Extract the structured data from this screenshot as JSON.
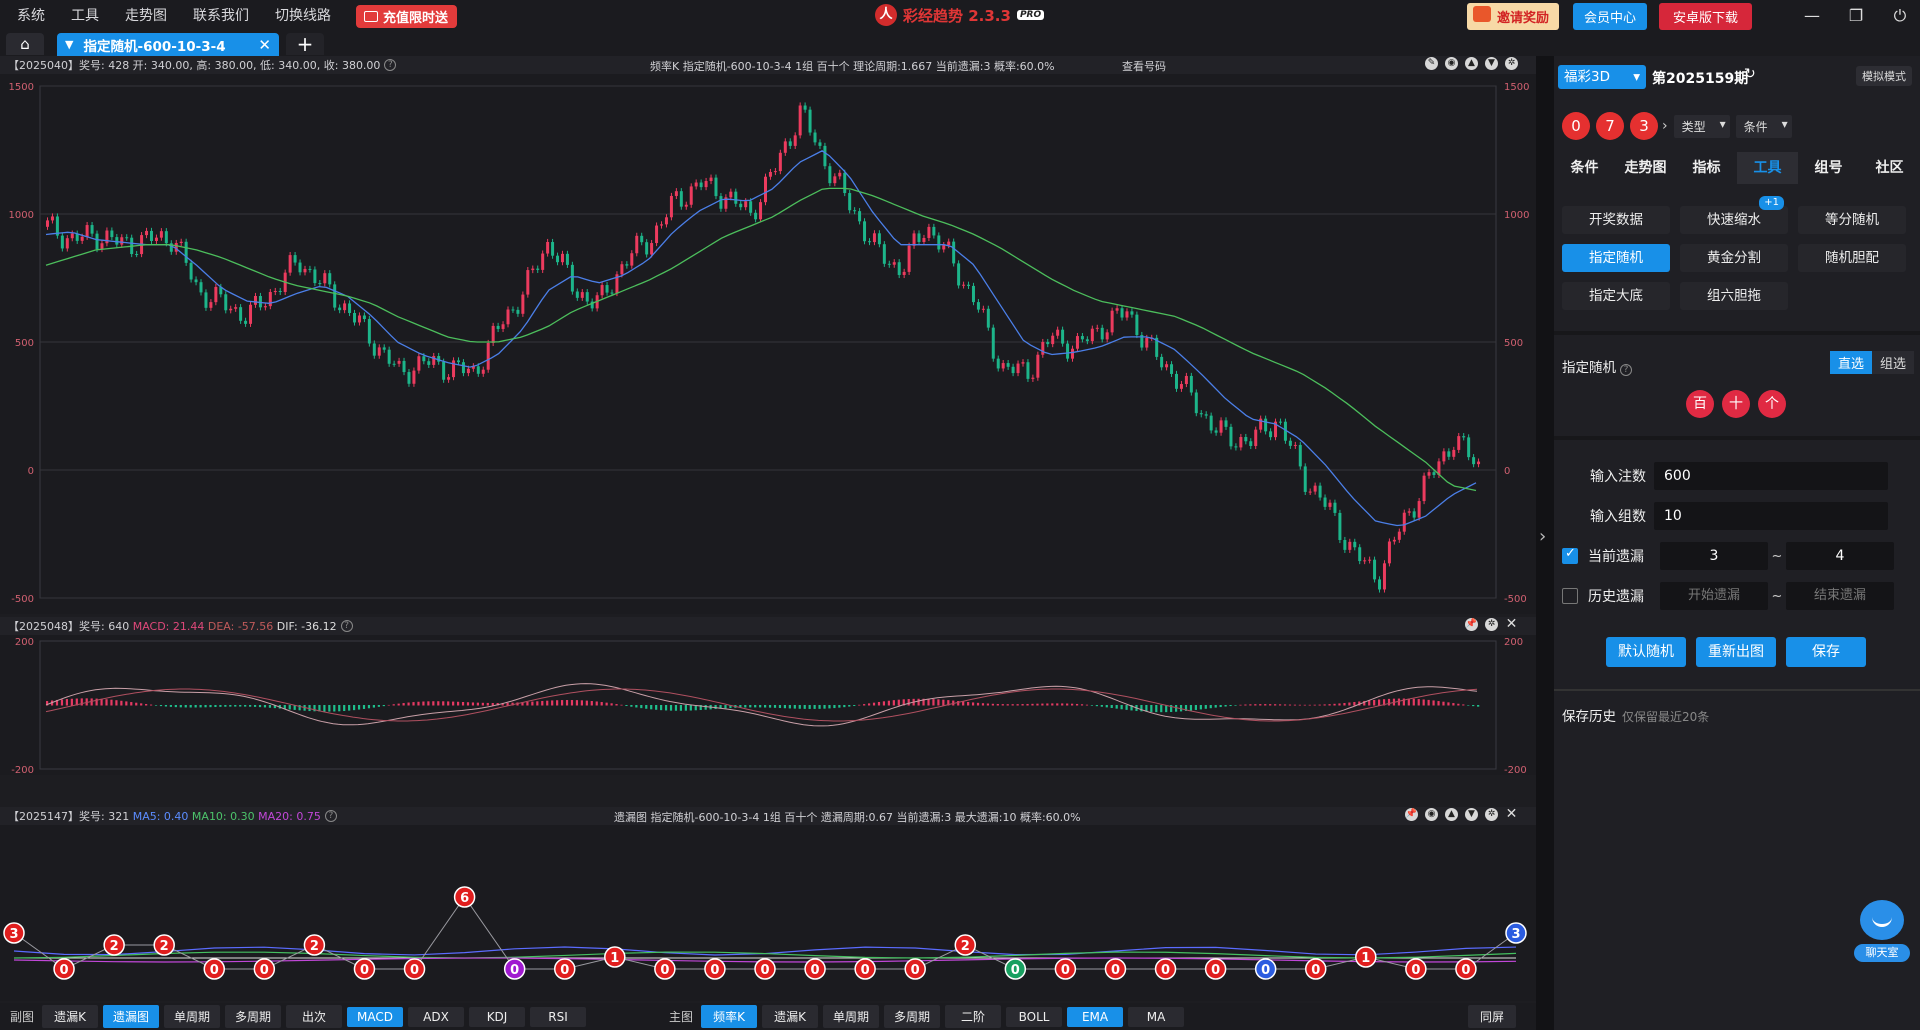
{
  "menu": [
    "系统",
    "工具",
    "走势图",
    "联系我们",
    "切换线路"
  ],
  "promo_label": "充值限时送",
  "app": {
    "name": "彩经趋势 2.3.3",
    "badge": "PRO"
  },
  "topright": {
    "invite": "邀请奖励",
    "vip": "会员中心",
    "android": "安卓版下载"
  },
  "tab": {
    "title": "指定随机-600-10-3-4"
  },
  "kchart": {
    "header_left": "【2025040】奖号: 428  开: 340.00, 高: 380.00, 低: 340.00, 收: 380.00",
    "header_mid": "频率K  指定随机-600-10-3-4  1组  百十个  理论周期:1.667  当前遗漏:3  概率:60.0%",
    "header_link": "查看号码",
    "yticks": [
      "1500",
      "1000",
      "500",
      "0",
      "-500"
    ]
  },
  "macd": {
    "header_prefix": "【2025048】奖号: 640",
    "macd_label": "MACD: 21.44",
    "dea_label": "DEA: -57.56",
    "dif_label": "DIF: -36.12",
    "yticks": [
      "200",
      "-200"
    ]
  },
  "miss": {
    "header_prefix": "【2025147】奖号: 321",
    "ma5": "MA5: 0.40",
    "ma10": "MA10: 0.30",
    "ma20": "MA20: 0.75",
    "header_mid": "遗漏图  指定随机-600-10-3-4  1组  百十个  遗漏周期:0.67  当前遗漏:3  最大遗漏:10  概率:60.0%"
  },
  "chart_data": [
    {
      "type": "line",
      "title": "频率K",
      "ylim": [
        -500,
        1500
      ],
      "series": [
        {
          "values": [
            950,
            900,
            920,
            880,
            900,
            910,
            700,
            650,
            600,
            700,
            820,
            720,
            620,
            500,
            380,
            420,
            400,
            380,
            560,
            700,
            900,
            700,
            650,
            820,
            900,
            1050,
            1120,
            1070,
            1000,
            1180,
            1400,
            1200,
            1030,
            860,
            780,
            960,
            820,
            650,
            400,
            380,
            520,
            480,
            560,
            620,
            460,
            360,
            220,
            120,
            120,
            200,
            -20,
            -150,
            -320,
            -420,
            -200,
            -40,
            120,
            20
          ]
        },
        {
          "values": [
            920,
            930,
            900,
            890,
            880,
            880,
            800,
            710,
            660,
            650,
            690,
            720,
            680,
            600,
            500,
            450,
            420,
            400,
            450,
            550,
            700,
            760,
            730,
            760,
            820,
            930,
            1010,
            1060,
            1050,
            1100,
            1200,
            1250,
            1150,
            1000,
            880,
            880,
            880,
            800,
            650,
            500,
            450,
            460,
            480,
            520,
            520,
            470,
            380,
            280,
            200,
            180,
            120,
            20,
            -100,
            -200,
            -220,
            -180,
            -100,
            -50
          ]
        },
        {
          "values": [
            800,
            830,
            860,
            870,
            880,
            880,
            860,
            830,
            790,
            750,
            720,
            700,
            680,
            650,
            600,
            560,
            520,
            500,
            500,
            520,
            560,
            620,
            660,
            700,
            740,
            790,
            850,
            910,
            950,
            990,
            1050,
            1100,
            1100,
            1070,
            1030,
            990,
            960,
            920,
            870,
            810,
            750,
            700,
            660,
            640,
            620,
            600,
            560,
            510,
            460,
            420,
            380,
            320,
            250,
            170,
            100,
            30,
            -60,
            -80
          ]
        }
      ]
    },
    {
      "type": "bar",
      "title": "MACD",
      "ylim": [
        -200,
        200
      ],
      "series": [
        {
          "name": "MACD",
          "values": [
            21.44
          ]
        },
        {
          "name": "DEA",
          "values": [
            -57.56
          ]
        },
        {
          "name": "DIF",
          "values": [
            -36.12
          ]
        }
      ]
    },
    {
      "type": "scatter",
      "title": "遗漏图",
      "series": [
        {
          "values": [
            3,
            0,
            2,
            2,
            0,
            0,
            2,
            0,
            0,
            6,
            0,
            0,
            1,
            0,
            0,
            0,
            0,
            0,
            0,
            2,
            0,
            0,
            0,
            0,
            0,
            0,
            0,
            1,
            0,
            0,
            3
          ]
        }
      ]
    }
  ],
  "right": {
    "lottery": "福彩3D",
    "issue": "第2025159期",
    "mock_mode": "模拟模式",
    "balls": [
      "0",
      "7",
      "3"
    ],
    "type_select": "类型",
    "cond_select": "条件",
    "tabs": [
      "条件",
      "走势图",
      "指标",
      "工具",
      "组号",
      "社区"
    ],
    "tools": [
      "开奖数据",
      "快速缩水",
      "等分随机",
      "指定随机",
      "黄金分割",
      "随机胆配",
      "指定大底",
      "组六胆拖"
    ],
    "tool_badge": "+1",
    "section_title": "指定随机",
    "mode_direct": "直选",
    "mode_group": "组选",
    "positions": [
      "百",
      "十",
      "个"
    ],
    "input_count_label": "输入注数",
    "input_count": "600",
    "input_groups_label": "输入组数",
    "input_groups": "10",
    "cur_miss_label": "当前遗漏",
    "cur_miss_from": "3",
    "cur_miss_to": "4",
    "hist_miss_label": "历史遗漏",
    "hist_from_ph": "开始遗漏",
    "hist_to_ph": "结束遗漏",
    "tilde": "~",
    "btn_default": "默认随机",
    "btn_redraw": "重新出图",
    "btn_save": "保存",
    "history_title": "保存历史",
    "history_note": "仅保留最近20条"
  },
  "chatroom": "聊天室",
  "bottom": {
    "sub_label": "副图",
    "sub_btns": [
      "遗漏K",
      "遗漏图",
      "单周期",
      "多周期",
      "出次",
      "MACD",
      "ADX",
      "KDJ",
      "RSI"
    ],
    "main_label": "主图",
    "main_btns": [
      "频率K",
      "遗漏K",
      "单周期",
      "多周期",
      "二阶",
      "BOLL",
      "EMA",
      "MA"
    ],
    "same_screen": "同屏"
  }
}
